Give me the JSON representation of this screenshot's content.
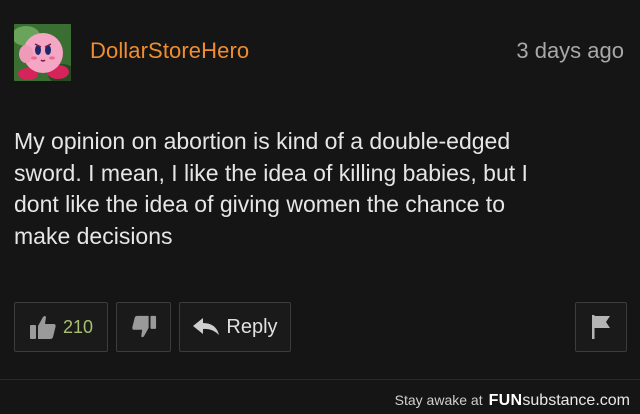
{
  "comment": {
    "username": "DollarStoreHero",
    "timestamp": "3 days ago",
    "body": "My opinion on abortion is kind of a double-edged\nsword. I mean, I like the idea of killing babies, but I\ndont like the idea of giving women the chance to\nmake decisions",
    "avatar_icon": "pink-character-avatar",
    "colors": {
      "username": "#f08d2e",
      "like_count": "#a8c070"
    }
  },
  "actions": {
    "like_count": "210",
    "like_icon": "thumbs-up-icon",
    "dislike_icon": "thumbs-down-icon",
    "reply_label": "Reply",
    "reply_icon": "reply-arrow-icon",
    "flag_icon": "flag-icon"
  },
  "footer": {
    "tagline": "Stay awake at",
    "logo_bold": "FUN",
    "logo_rest": "substance.com"
  }
}
